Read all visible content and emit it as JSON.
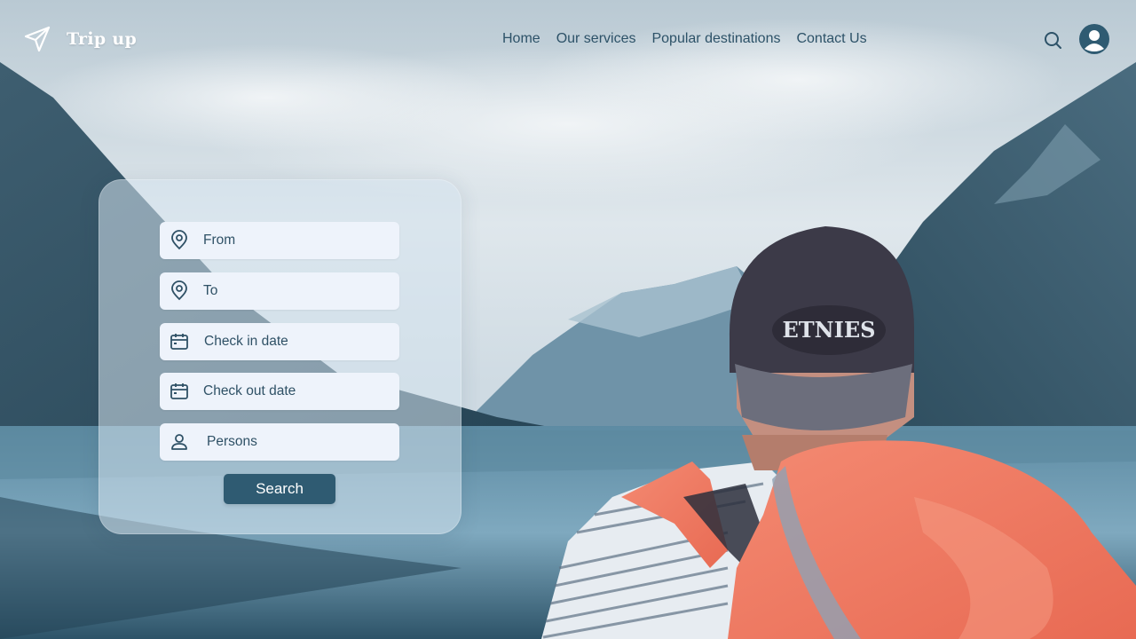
{
  "brand": {
    "name": "Trip up",
    "icon": "paper-plane-icon"
  },
  "nav": {
    "items": [
      {
        "label": "Home"
      },
      {
        "label": "Our services"
      },
      {
        "label": "Popular destinations"
      },
      {
        "label": "Contact Us"
      }
    ]
  },
  "header_actions": {
    "search_icon": "search-icon",
    "account_icon": "user-avatar-icon"
  },
  "search_form": {
    "fields": [
      {
        "placeholder": "From",
        "icon": "location-pin-icon"
      },
      {
        "placeholder": "To",
        "icon": "location-pin-icon"
      },
      {
        "placeholder": "Check in date",
        "icon": "calendar-icon"
      },
      {
        "placeholder": "Check out date",
        "icon": "calendar-icon"
      },
      {
        "placeholder": "Persons",
        "icon": "person-icon"
      }
    ],
    "submit_label": "Search"
  },
  "colors": {
    "accent": "#2f5b72",
    "nav_text": "#2d5268",
    "field_bg": "#eef3fb",
    "backpack": "#f07a62"
  }
}
